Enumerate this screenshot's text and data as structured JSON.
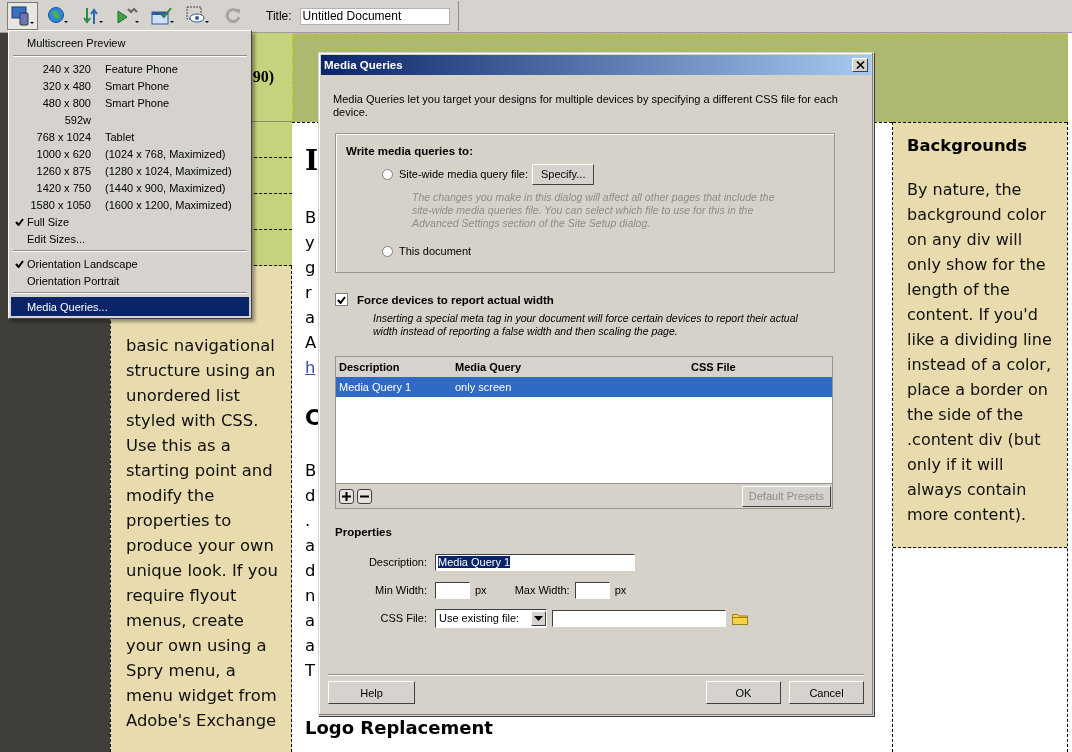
{
  "toolbar": {
    "buttons": [
      {
        "kind": "devices",
        "expanded": true,
        "disabled": false
      },
      {
        "kind": "globe",
        "expanded": false,
        "disabled": false
      },
      {
        "kind": "transfer",
        "expanded": false,
        "disabled": false
      },
      {
        "kind": "debug",
        "expanded": false,
        "disabled": false
      },
      {
        "kind": "check",
        "expanded": false,
        "disabled": false
      },
      {
        "kind": "eye",
        "expanded": false,
        "disabled": false
      },
      {
        "kind": "refresh",
        "expanded": false,
        "disabled": true
      }
    ],
    "title_label": "Title:",
    "title_value": "Untitled Document"
  },
  "menu": {
    "items": [
      {
        "kind": "item",
        "label": "Multiscreen Preview",
        "selected": false
      },
      {
        "kind": "separator"
      },
      {
        "kind": "size",
        "size": "240 x 320",
        "label": "Feature Phone",
        "selected": false
      },
      {
        "kind": "size",
        "size": "320 x 480",
        "label": "Smart Phone",
        "selected": false
      },
      {
        "kind": "size",
        "size": "480 x 800",
        "label": "Smart Phone",
        "selected": false
      },
      {
        "kind": "size",
        "size": "592w",
        "selected": false
      },
      {
        "kind": "size",
        "size": "768 x 1024",
        "label": "Tablet",
        "selected": false
      },
      {
        "kind": "size",
        "size": "1000 x 620",
        "label": "(1024 x 768, Maximized)",
        "selected": false
      },
      {
        "kind": "size",
        "size": "1260 x 875",
        "label": "(1280 x 1024, Maximized)",
        "selected": false
      },
      {
        "kind": "size",
        "size": "1420 x 750",
        "label": "(1440 x 900, Maximized)",
        "selected": false
      },
      {
        "kind": "size",
        "size": "1580 x 1050",
        "label": "(1600 x 1200, Maximized)",
        "selected": false
      },
      {
        "kind": "check",
        "label": "Full Size",
        "checked": true,
        "selected": false
      },
      {
        "kind": "check",
        "label": "Edit Sizes...",
        "checked": false,
        "selected": false
      },
      {
        "kind": "separator"
      },
      {
        "kind": "check",
        "label": "Orientation Landscape",
        "checked": true,
        "selected": false
      },
      {
        "kind": "check",
        "label": "Orientation Portrait",
        "checked": false,
        "selected": false
      },
      {
        "kind": "separator"
      },
      {
        "kind": "item",
        "label": "Media Queries...",
        "selected": true
      }
    ]
  },
  "page": {
    "header_fragment": "90)",
    "sidebar_text": "basic navigational structure using an unordered list styled with CSS. Use this as a starting point and modify the properties to produce your own unique look. If you require flyout menus, create your own using a Spry menu, a menu widget from Adobe's Exchange",
    "content": [
      {
        "kind": "heading",
        "text": "I"
      },
      {
        "kind": "line",
        "text": "B"
      },
      {
        "kind": "line",
        "text": "y"
      },
      {
        "kind": "line",
        "text": "g"
      },
      {
        "kind": "line",
        "text": "r"
      },
      {
        "kind": "line",
        "text": "a"
      },
      {
        "kind": "line",
        "text": "A"
      },
      {
        "kind": "link",
        "text": "h"
      },
      {
        "kind": "heading",
        "text": "C"
      },
      {
        "kind": "line",
        "text": "B"
      },
      {
        "kind": "line",
        "text": "d"
      },
      {
        "kind": "line",
        "text": "."
      },
      {
        "kind": "line",
        "text": "a"
      },
      {
        "kind": "line",
        "text": "d"
      },
      {
        "kind": "line",
        "text": "n"
      },
      {
        "kind": "line",
        "text": "a"
      },
      {
        "kind": "line",
        "text": "a"
      },
      {
        "kind": "line",
        "text": "T"
      },
      {
        "kind": "subheading",
        "text": "Logo Replacement"
      }
    ],
    "aside_heading": "Backgrounds",
    "aside_text": "By nature, the background color on any div will only show for the length of the content. If you'd like a dividing line instead of a color, place a border on the side of the .content div (but only if it will always contain more content)."
  },
  "dialog": {
    "title": "Media Queries",
    "intro": "Media Queries let you target your designs for multiple devices by specifying a different CSS file for each device.",
    "group": {
      "legend": "Write media queries to:",
      "options": [
        {
          "kind": "site",
          "label": "Site-wide media query file:",
          "selected": false,
          "button": "Specify...",
          "note": "The changes you make in this dialog will affect all other pages that include the site-wide media queries file. You can select which file to use for this in the Advanced Settings section of the Site Setup dialog."
        },
        {
          "kind": "document",
          "label": "This document",
          "selected": false
        }
      ]
    },
    "force_width": {
      "label": "Force devices to report actual width",
      "checked": true,
      "note": "Inserting a special meta tag in your document will force certain devices to report their actual width instead of reporting a false width and then scaling the page."
    },
    "table": {
      "columns": [
        "Description",
        "Media Query",
        "CSS File"
      ],
      "rows": [
        {
          "cells": [
            "Media Query 1",
            "only screen"
          ],
          "selected": true
        }
      ]
    },
    "default_presets": {
      "label": "Default Presets",
      "disabled": true
    },
    "properties": {
      "heading": "Properties",
      "description": {
        "label": "Description:",
        "value": "Media Query 1"
      },
      "min_width": {
        "label": "Min Width:",
        "unit": "px"
      },
      "max_width": {
        "label": "Max Width:",
        "unit": "px"
      },
      "css_file": {
        "label": "CSS File:",
        "value": "Use existing file:"
      }
    },
    "buttons": [
      {
        "kind": "help",
        "label": "Help"
      },
      {
        "kind": "ok",
        "label": "OK"
      },
      {
        "kind": "cancel",
        "label": "Cancel"
      }
    ]
  }
}
